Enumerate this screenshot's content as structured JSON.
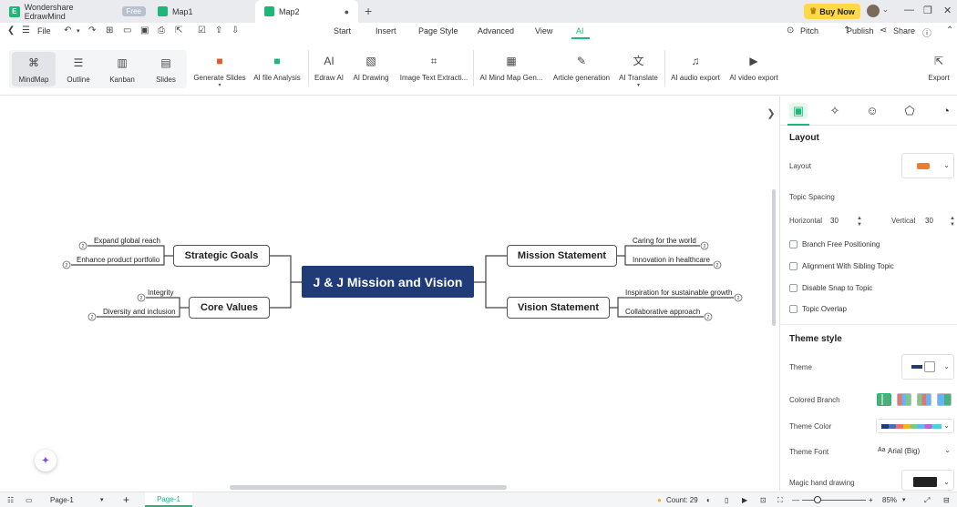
{
  "titlebar": {
    "app_name": "Wondershare EdrawMind",
    "plan_badge": "Free",
    "tabs": [
      {
        "label": "Map1"
      },
      {
        "label": "Map2"
      }
    ],
    "buy_now": "Buy Now"
  },
  "menubar": {
    "file": "File",
    "tabs": [
      "Start",
      "Insert",
      "Page Style",
      "Advanced",
      "View",
      "AI"
    ],
    "active_tab": "AI",
    "right": {
      "pitch": "Pitch",
      "publish": "Publish",
      "share": "Share"
    }
  },
  "ribbon": {
    "views": [
      {
        "label": "MindMap",
        "icon": "mindmap-icon"
      },
      {
        "label": "Outline",
        "icon": "outline-icon"
      },
      {
        "label": "Kanban",
        "icon": "kanban-icon"
      },
      {
        "label": "Slides",
        "icon": "slides-icon"
      }
    ],
    "ai_tools": [
      {
        "label": "Generate Slides",
        "icon": "ppt-icon"
      },
      {
        "label": "AI file Analysis",
        "icon": "file-analysis-icon"
      },
      {
        "label": "Edraw AI",
        "icon": "edraw-ai-icon"
      },
      {
        "label": "AI Drawing",
        "icon": "ai-drawing-icon"
      },
      {
        "label": "Image Text Extracti...",
        "icon": "image-text-icon"
      },
      {
        "label": "AI Mind Map Gen...",
        "icon": "ai-mindmap-icon"
      },
      {
        "label": "Article generation",
        "icon": "article-icon"
      },
      {
        "label": "AI Translate",
        "icon": "translate-icon"
      },
      {
        "label": "AI audio export",
        "icon": "audio-export-icon"
      },
      {
        "label": "AI video export",
        "icon": "video-export-icon"
      },
      {
        "label": "Export",
        "icon": "export-icon"
      }
    ]
  },
  "mindmap": {
    "central": "J & J Mission and Vision",
    "left_branches": [
      {
        "title": "Strategic Goals",
        "subs": [
          "Expand global reach",
          "Enhance product portfolio"
        ]
      },
      {
        "title": "Core Values",
        "subs": [
          "Integrity",
          "Diversity and inclusion"
        ]
      }
    ],
    "right_branches": [
      {
        "title": "Mission Statement",
        "subs": [
          "Caring for the world",
          "Innovation in healthcare"
        ]
      },
      {
        "title": "Vision Statement",
        "subs": [
          "Inspiration for sustainable growth",
          "Collaborative approach"
        ]
      }
    ],
    "sub_badge": "2"
  },
  "panel": {
    "layout_section": "Layout",
    "layout_label": "Layout",
    "topic_spacing": "Topic Spacing",
    "horizontal_label": "Horizontal",
    "horizontal_value": "30",
    "vertical_label": "Vertical",
    "vertical_value": "30",
    "checkboxes": [
      "Branch Free Positioning",
      "Alignment With Sibling Topic",
      "Disable Snap to Topic",
      "Topic Overlap"
    ],
    "theme_section": "Theme style",
    "theme_label": "Theme",
    "colored_branch_label": "Colored Branch",
    "theme_color_label": "Theme Color",
    "theme_font_label": "Theme Font",
    "theme_font_value": "Arial (Big)",
    "magic_hand_label": "Magic hand drawing",
    "colors": {
      "accent": "#1bb87a",
      "central_topic": "#1f3c78"
    }
  },
  "statusbar": {
    "page_select": "Page-1",
    "page_tab": "Page-1",
    "count": "Count: 29",
    "zoom": "85%"
  }
}
